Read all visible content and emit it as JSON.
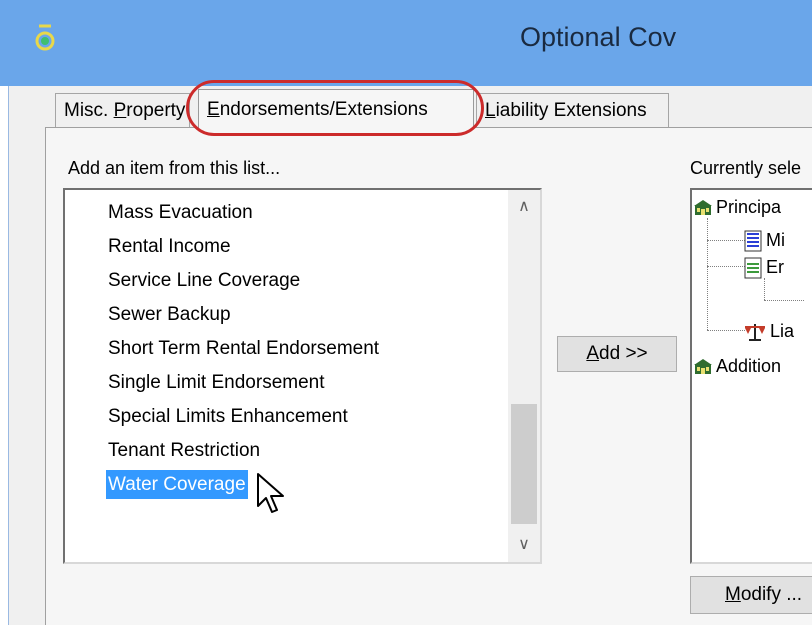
{
  "window": {
    "title": "Optional Cov"
  },
  "tabs": [
    {
      "label_pre": "Misc. ",
      "label_u": "P",
      "label_post": "roperty"
    },
    {
      "label_pre": "",
      "label_u": "E",
      "label_post": "ndorsements/Extensions"
    },
    {
      "label_pre": "",
      "label_u": "L",
      "label_post": "iability Extensions"
    }
  ],
  "left_panel": {
    "heading": "Add an item from this list...",
    "items": [
      "Mass Evacuation",
      "Rental Income",
      "Service Line Coverage",
      "Sewer Backup",
      "Short Term Rental Endorsement",
      "Single Limit Endorsement",
      "Special Limits Enhancement",
      "Tenant Restriction",
      "Water Coverage"
    ],
    "selected_item": "Water Coverage"
  },
  "add_button": {
    "u": "A",
    "rest": "dd >>"
  },
  "right_panel": {
    "heading": "Currently sele",
    "tree": [
      {
        "label": "Principa",
        "icon": "building-icon"
      },
      {
        "label": "Mi",
        "icon": "document-blue-icon"
      },
      {
        "label": "Er",
        "icon": "document-green-icon"
      },
      {
        "label": "Lia",
        "icon": "scales-icon"
      },
      {
        "label": "Addition",
        "icon": "building-icon"
      }
    ]
  },
  "modify_button": {
    "u": "M",
    "rest": "odify ..."
  },
  "colors": {
    "titlebar": "#6aa6ea",
    "selection": "#3399ff",
    "highlight_ring": "#cc2b2b"
  }
}
